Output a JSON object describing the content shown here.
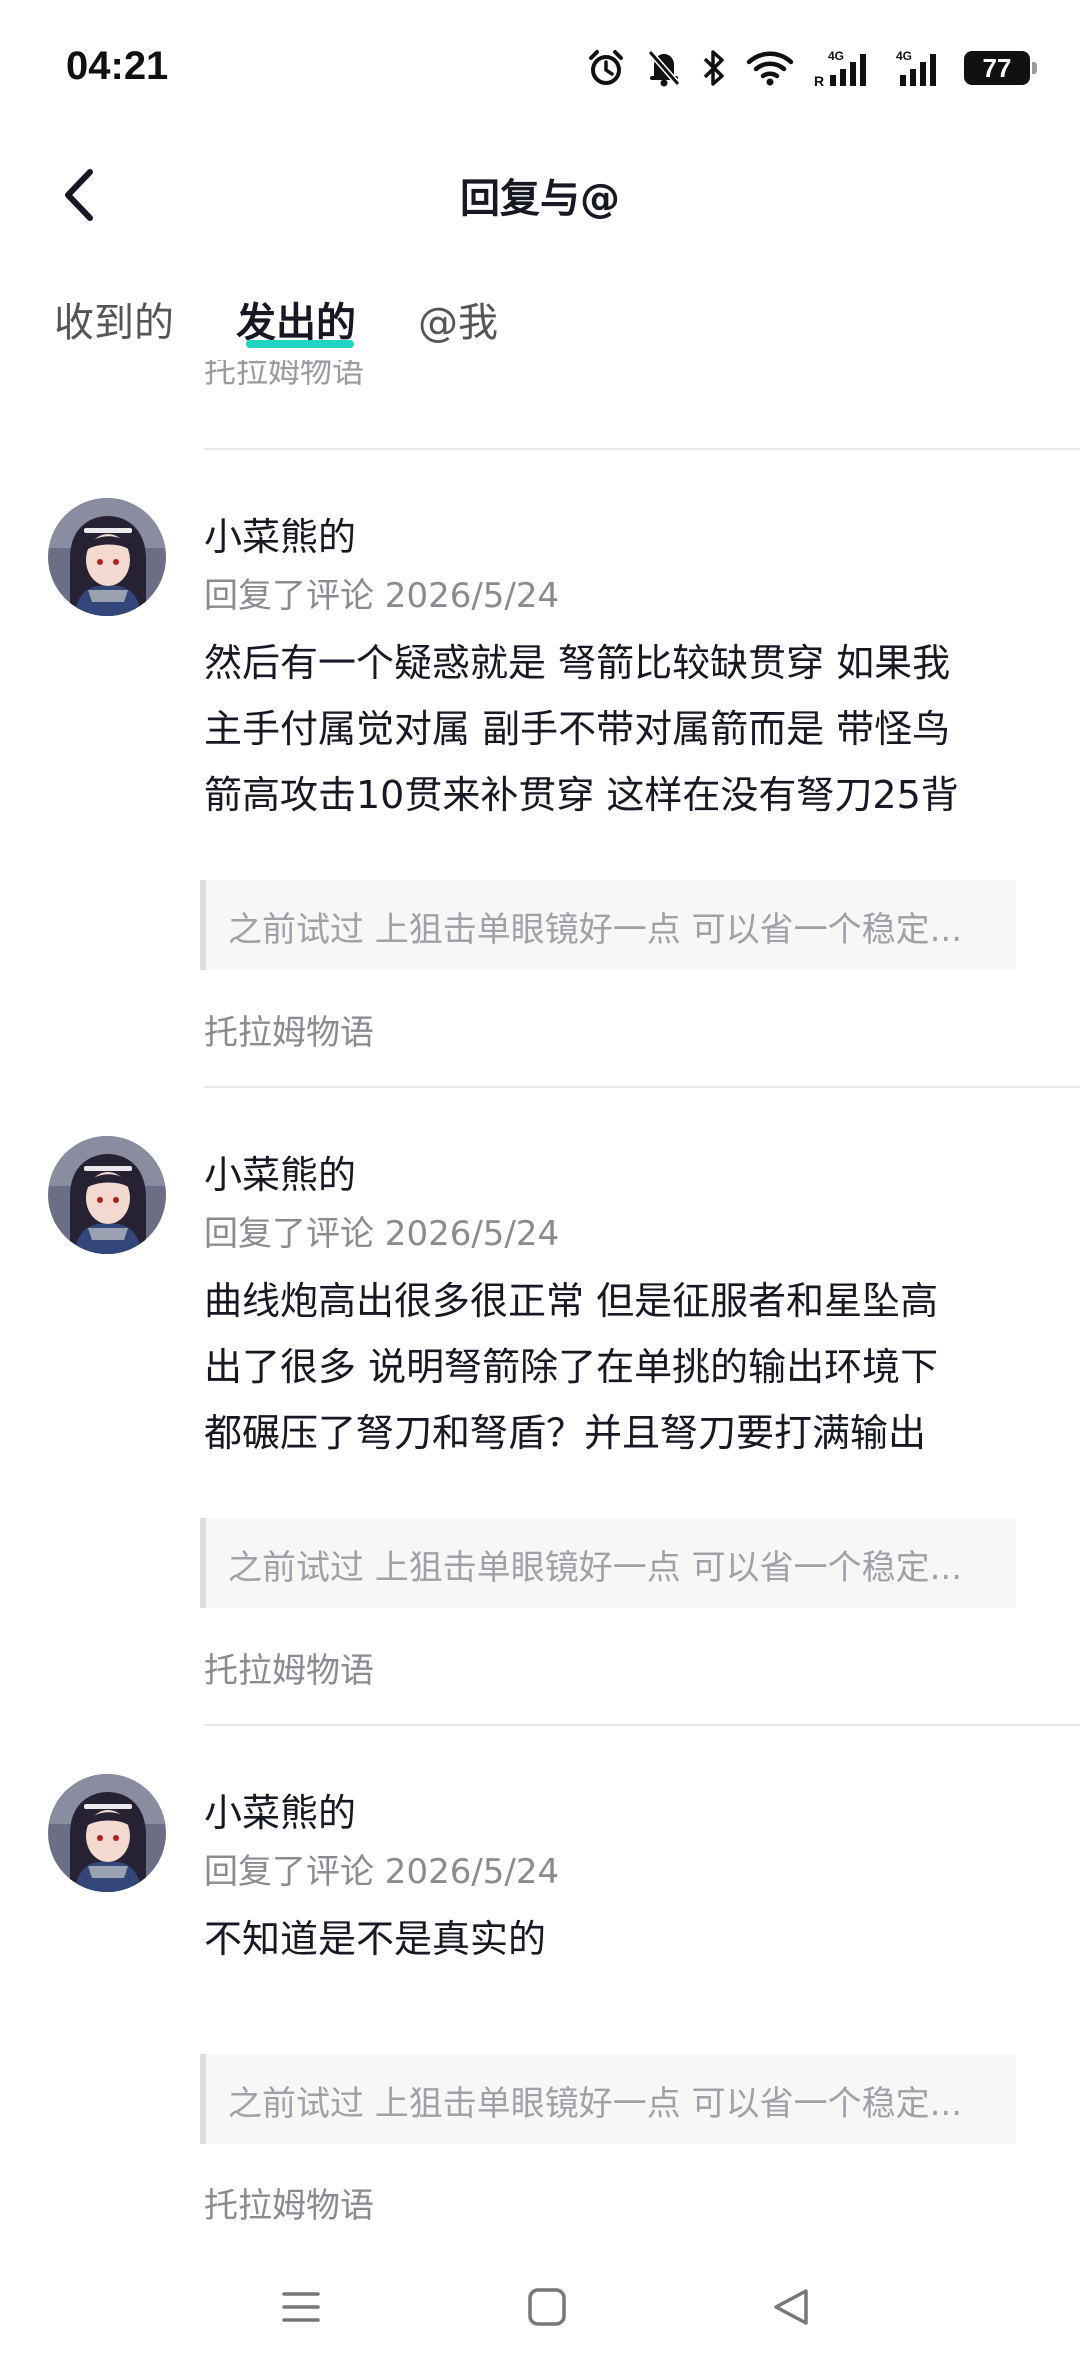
{
  "status_bar": {
    "time": "04:21",
    "battery": "77",
    "icons": [
      "alarm-icon",
      "mute-bell-icon",
      "bluetooth-icon",
      "wifi-icon",
      "signal-4g-roaming-icon",
      "signal-4g-icon",
      "battery-icon"
    ]
  },
  "header": {
    "title": "回复与@",
    "back_icon": "chevron-left-icon"
  },
  "tabs": [
    {
      "label": "收到的",
      "active": false
    },
    {
      "label": "发出的",
      "active": true
    },
    {
      "label": "@我",
      "active": false
    }
  ],
  "accent_color": "#20d5c4",
  "list": {
    "clipped_source": "托拉姆物语",
    "items": [
      {
        "name": "小菜熊的",
        "meta": "回复了评论 2026/5/24",
        "lines": [
          "然后有一个疑惑就是 弩箭比较缺贯穿 如果我",
          "主手付属觉对属 副手不带对属箭而是 带怪鸟",
          "箭高攻击10贯来补贯穿 这样在没有弩刀25背"
        ],
        "quote": "之前试过 上狙击单眼镜好一点 可以省一个稳定...",
        "source": "托拉姆物语"
      },
      {
        "name": "小菜熊的",
        "meta": "回复了评论 2026/5/24",
        "lines": [
          "曲线炮高出很多很正常 但是征服者和星坠高",
          "出了很多 说明弩箭除了在单挑的输出环境下",
          "都碾压了弩刀和弩盾？并且弩刀要打满输出"
        ],
        "quote": "之前试过 上狙击单眼镜好一点 可以省一个稳定...",
        "source": "托拉姆物语"
      },
      {
        "name": "小菜熊的",
        "meta": "回复了评论 2026/5/24",
        "lines": [
          "不知道是不是真实的"
        ],
        "quote": "之前试过 上狙击单眼镜好一点 可以省一个稳定...",
        "source": "托拉姆物语"
      }
    ]
  },
  "nav_bar": {
    "buttons": [
      "menu-icon",
      "home-square-icon",
      "back-triangle-icon"
    ]
  }
}
